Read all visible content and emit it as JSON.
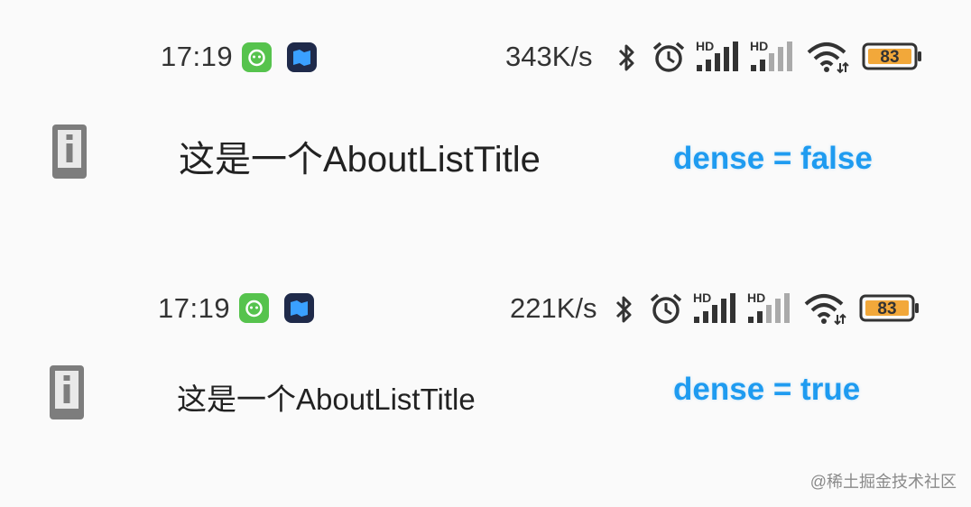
{
  "panels": [
    {
      "status": {
        "time": "17:19",
        "net_speed": "343K/s",
        "battery": "83"
      },
      "tile": {
        "title": "这是一个AboutListTitle",
        "dense_label": "dense = false",
        "icon": "info-icon"
      }
    },
    {
      "status": {
        "time": "17:19",
        "net_speed": "221K/s",
        "battery": "83"
      },
      "tile": {
        "title": "这是一个AboutListTitle",
        "dense_label": "dense = true",
        "icon": "info-icon"
      }
    }
  ],
  "hd_label": "HD",
  "watermark": "@稀土掘金技术社区",
  "colors": {
    "accent": "#1e9bf0",
    "battery_fill": "#f2a83a",
    "app_green": "#56c34d",
    "app_blue": "#1f2a4a"
  }
}
